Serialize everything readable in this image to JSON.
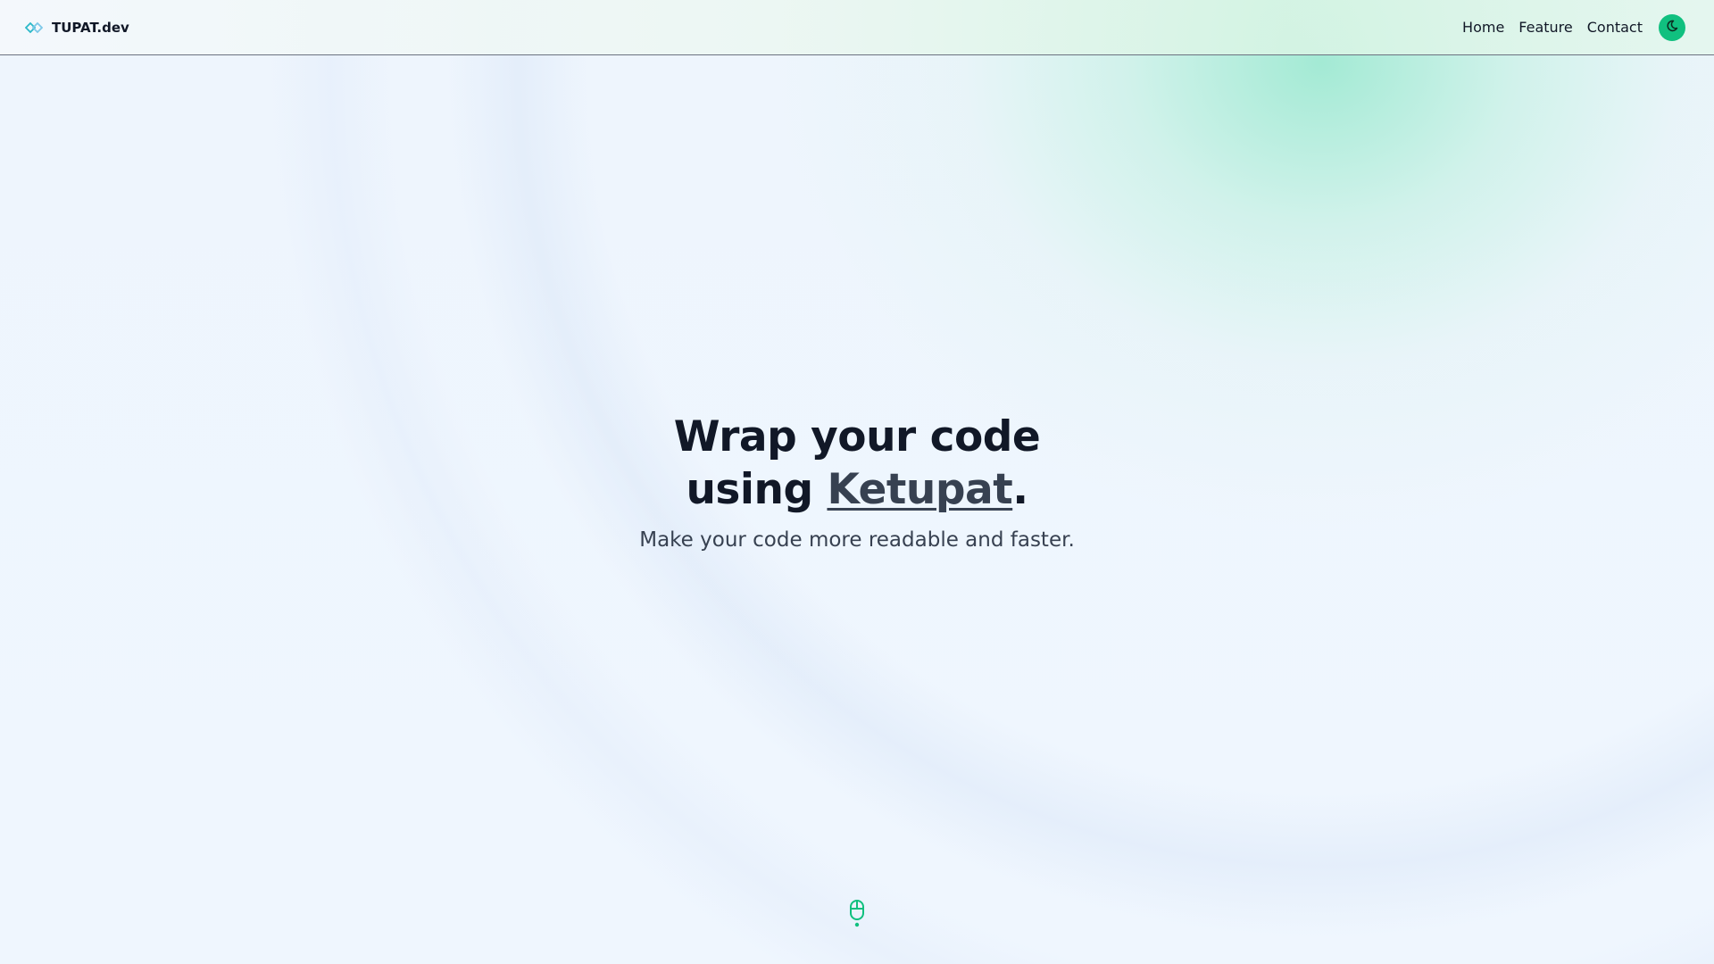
{
  "header": {
    "brand": "TUPAT.dev",
    "brand_icon": "diamond-link-icon",
    "nav": [
      {
        "label": "Home",
        "active": true
      },
      {
        "label": "Feature",
        "active": false
      },
      {
        "label": "Contact",
        "active": false
      }
    ],
    "theme_toggle_icon": "moon-icon"
  },
  "hero": {
    "title_line1": "Wrap your code",
    "title_prefix": "using ",
    "title_accent": "Ketupat",
    "title_suffix": ".",
    "subtitle": "Make your code more readable and faster."
  },
  "scroll_indicator_icon": "mouse-scroll-icon",
  "colors": {
    "accent": "#10c07f",
    "brand_icon": "#2bb8c9",
    "text": "#111827",
    "muted": "#374151"
  }
}
